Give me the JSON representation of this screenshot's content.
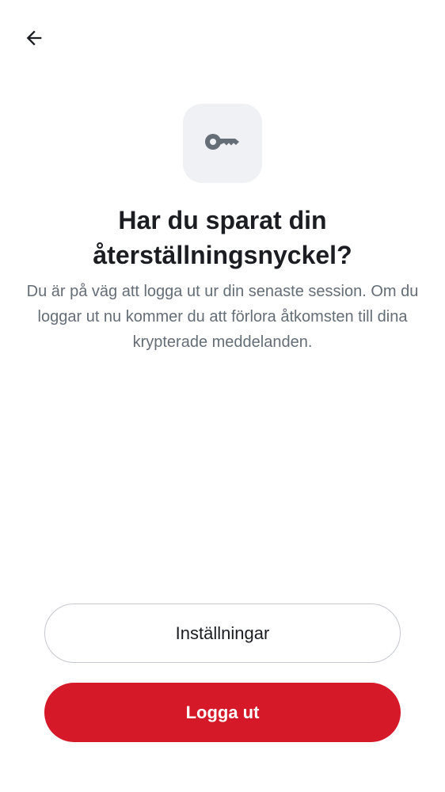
{
  "header": {
    "back_icon": "arrow-left-icon"
  },
  "hero": {
    "icon": "key-icon",
    "icon_color": "#656d77",
    "tile_color": "#eff1f5"
  },
  "content": {
    "title": "Har du sparat din återställningsnyckel?",
    "description": "Du är på väg att logga ut ur din senaste session. Om du loggar ut nu kommer du att förlora åtkomsten till dina krypterade meddelanden."
  },
  "actions": {
    "settings_label": "Inställningar",
    "logout_label": "Logga ut",
    "logout_color": "#d51928"
  }
}
